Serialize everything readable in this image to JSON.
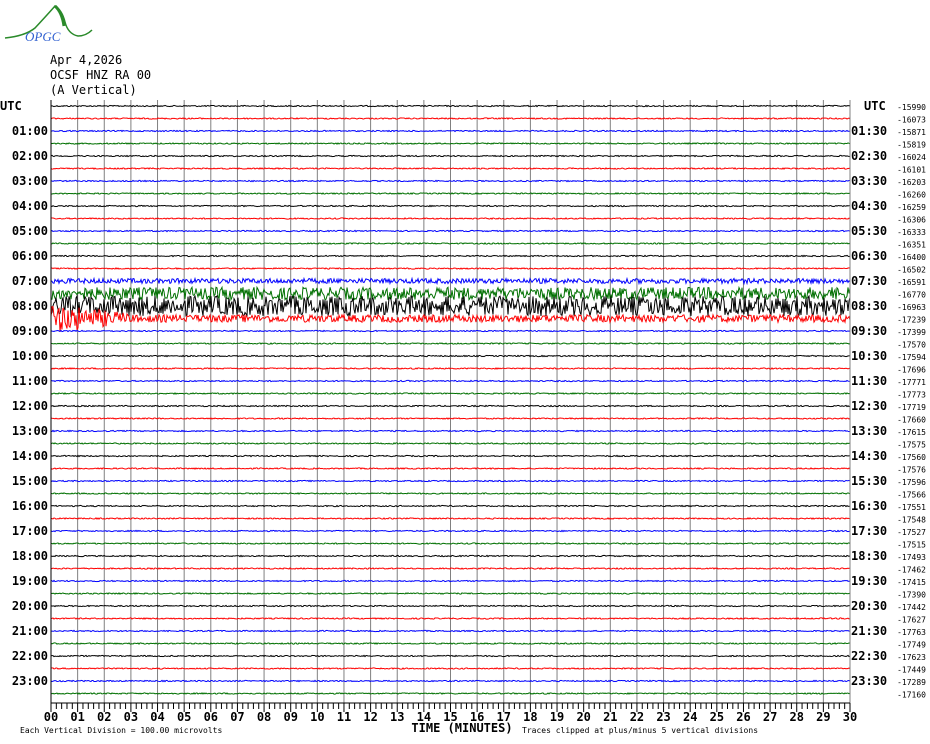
{
  "logo_text": "OPGC",
  "header": {
    "date": "Apr 4,2026",
    "station": "OCSF HNZ RA 00",
    "component": "(A Vertical)"
  },
  "chart_data": {
    "type": "line",
    "subtype": "helicorder",
    "left_axis_title": "UTC",
    "right_axis_title": "UTC",
    "xlabel": "TIME (MINUTES)",
    "xlim": [
      0,
      30
    ],
    "x_ticks": [
      "00",
      "01",
      "02",
      "03",
      "04",
      "05",
      "06",
      "07",
      "08",
      "09",
      "10",
      "11",
      "12",
      "13",
      "14",
      "15",
      "16",
      "17",
      "18",
      "19",
      "20",
      "21",
      "22",
      "23",
      "24",
      "25",
      "26",
      "27",
      "28",
      "29",
      "30"
    ],
    "left_labels": [
      "",
      "01:00",
      "02:00",
      "03:00",
      "04:00",
      "05:00",
      "06:00",
      "07:00",
      "08:00",
      "09:00",
      "10:00",
      "11:00",
      "12:00",
      "13:00",
      "14:00",
      "15:00",
      "16:00",
      "17:00",
      "18:00",
      "19:00",
      "20:00",
      "21:00",
      "22:00",
      "23:00"
    ],
    "right_labels": [
      "",
      "01:30",
      "02:30",
      "03:30",
      "04:30",
      "05:30",
      "06:30",
      "07:30",
      "08:30",
      "09:30",
      "10:30",
      "11:30",
      "12:30",
      "13:30",
      "14:30",
      "15:30",
      "16:30",
      "17:30",
      "18:30",
      "19:30",
      "20:30",
      "21:30",
      "22:30",
      "23:30"
    ],
    "row_offsets": [
      -15990,
      -16073,
      -15871,
      -15819,
      -16024,
      -16101,
      -16203,
      -16260,
      -16259,
      -16306,
      -16333,
      -16351,
      -16400,
      -16502,
      -16591,
      -16770,
      -16963,
      -17239,
      -17399,
      -17570,
      -17594,
      -17696,
      -17771,
      -17773,
      -17719,
      -17660,
      -17615,
      -17575,
      -17560,
      -17576,
      -17596,
      -17566,
      -17551,
      -17548,
      -17527,
      -17515,
      -17493,
      -17462,
      -17415,
      -17390,
      -17442,
      -17627,
      -17763,
      -17749,
      -17623,
      -17449,
      -17289,
      -17160
    ],
    "row_colors": [
      "#000000",
      "#ff0000",
      "#0000ff",
      "#007000"
    ],
    "noisy_rows_amplitude_divisions": {
      "14": 0.2,
      "15": 0.5,
      "16": 0.8,
      "17": 0.3
    },
    "grid": true,
    "grid_color": "#808080",
    "footer_left": "Each Vertical Division =  100.00 microvolts",
    "footer_right": "Traces clipped at plus/minus 5 vertical divisions"
  }
}
